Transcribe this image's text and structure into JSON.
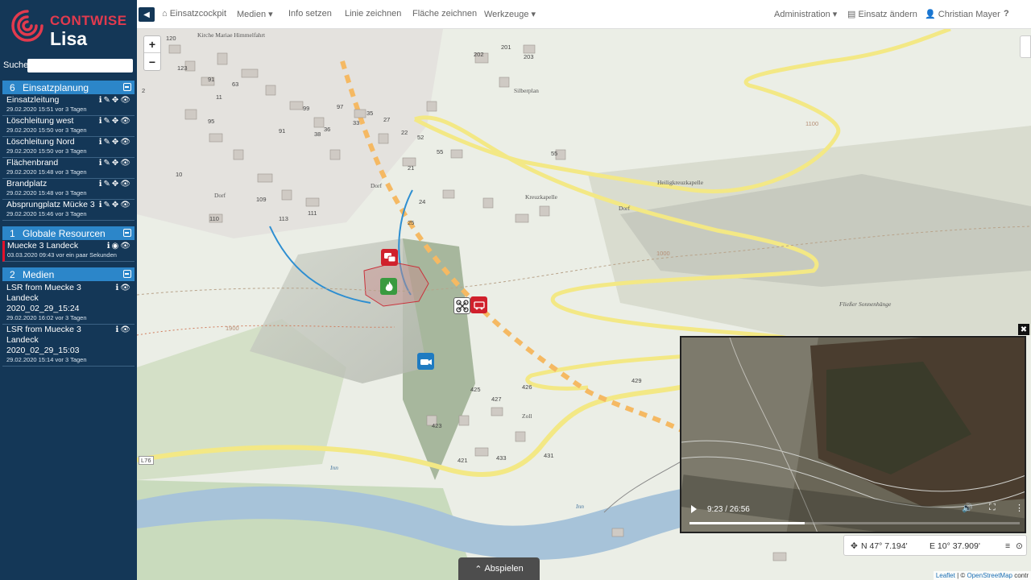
{
  "app": {
    "brand": "CONTWISE",
    "product": "Lisa",
    "colors": {
      "sidebar": "#143757",
      "section_head": "#2c86c9",
      "brand_red": "#e23a4e",
      "road_yellow": "#f3e885",
      "river_blue": "#a7c3d9"
    }
  },
  "search": {
    "label": "Suche",
    "value": ""
  },
  "sections": {
    "planning": {
      "count": "6",
      "title": "Einsatzplanung",
      "items": [
        {
          "title": "Einsatzleitung",
          "meta": "29.02.2020 15:51 vor 3 Tagen"
        },
        {
          "title": "Löschleitung west",
          "meta": "29.02.2020 15:50 vor 3 Tagen"
        },
        {
          "title": "Löschleitung Nord",
          "meta": "29.02.2020 15:50 vor 3 Tagen"
        },
        {
          "title": "Flächenbrand",
          "meta": "29.02.2020 15:48 vor 3 Tagen"
        },
        {
          "title": "Brandplatz",
          "meta": "29.02.2020 15:48 vor 3 Tagen"
        },
        {
          "title": "Absprungplatz Mücke 3",
          "meta": "29.02.2020 15:46 vor 3 Tagen"
        }
      ]
    },
    "resources": {
      "count": "1",
      "title": "Globale Resourcen",
      "items": [
        {
          "title": "Muecke 3 Landeck",
          "meta": "03.03.2020 09:43 vor ein paar Sekunden"
        }
      ]
    },
    "media": {
      "count": "2",
      "title": "Medien",
      "items": [
        {
          "line1": "LSR from Muecke 3",
          "line2": "Landeck",
          "line3": "2020_02_29_15:24",
          "meta": "29.02.2020 16:02 vor 3 Tagen"
        },
        {
          "line1": "LSR from Muecke 3",
          "line2": "Landeck",
          "line3": "2020_02_29_15:03",
          "meta": "29.02.2020 15:14 vor 3 Tagen"
        }
      ]
    }
  },
  "nav": {
    "items": [
      "Einsatzcockpit",
      "Medien ▾",
      "Info setzen",
      "Linie zeichnen",
      "Fläche zeichnen",
      "Werkzeuge ▾"
    ],
    "admin": "Administration ▾",
    "change": "Einsatz ändern",
    "user": "Christian Mayer",
    "help": "?"
  },
  "map": {
    "zoom_in": "+",
    "zoom_out": "−",
    "labels": {
      "kirche": "Kirche Mariae Himmelfahrt",
      "silberplan": "Silberplan",
      "dorf1": "Dorf",
      "dorf2": "Dorf",
      "dorf3": "Dorf",
      "kreuzkapelle": "Kreuzkapelle",
      "heiligkreuz": "Heiligkreuzkapelle",
      "sonnenhaenge": "Fließer Sonnenhänge",
      "zoll": "Zoll",
      "inn1": "Inn",
      "inn2": "Inn",
      "l76": "L76",
      "c1900": "1900",
      "c1000": "1000",
      "c1100": "1100"
    },
    "house_numbers": [
      "120",
      "122",
      "123",
      "2",
      "91",
      "11",
      "63",
      "35",
      "95",
      "99",
      "97",
      "91",
      "33",
      "10",
      "202",
      "201",
      "203",
      "38",
      "36",
      "109",
      "110",
      "111",
      "113",
      "27",
      "25",
      "21",
      "22",
      "24",
      "55",
      "52",
      "55",
      "429",
      "427",
      "425",
      "426",
      "423",
      "431",
      "421",
      "433"
    ],
    "play_tab": "Abspielen",
    "attribution_leaflet": "Leaflet",
    "attribution_sep": " | © ",
    "attribution_osm": "OpenStreetMap",
    "attribution_tail": " contr"
  },
  "video": {
    "close": "✖",
    "time": "9:23 / 26:56",
    "progress": 0.348
  },
  "coords": {
    "north": "N 47° 7.194'",
    "east": "E 10° 37.909'"
  }
}
